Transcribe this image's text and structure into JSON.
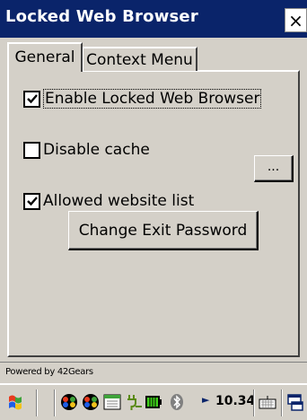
{
  "window": {
    "title": "Locked Web Browser",
    "close_glyph": "×"
  },
  "tabs": [
    {
      "label": "General",
      "active": true
    },
    {
      "label": "Context Menu",
      "active": false
    }
  ],
  "settings": {
    "enable_locked_browser": {
      "label": "Enable Locked Web Browser",
      "checked": true
    },
    "disable_cache": {
      "label": "Disable cache",
      "checked": false
    },
    "allowed_website_list": {
      "label": "Allowed website list",
      "checked": true,
      "button_label": "..."
    }
  },
  "change_password_button": "Change Exit Password",
  "footer": {
    "text": "Powered by 42Gears"
  },
  "taskbar": {
    "time": "10.34",
    "icons": [
      "start-flag-icon",
      "network-icon",
      "network-icon",
      "calendar-icon",
      "power-plug-icon",
      "battery-icon",
      "bluetooth-icon",
      "tray-arrow-icon",
      "keyboard-icon",
      "desktop-icon"
    ]
  },
  "colors": {
    "titlebar": "#0a246a",
    "face": "#d4d0c8"
  }
}
